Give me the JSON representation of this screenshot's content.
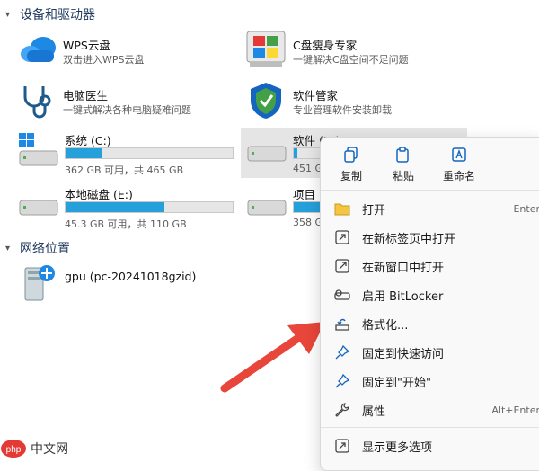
{
  "sections": {
    "devices": "设备和驱动器",
    "network": "网络位置"
  },
  "apps": [
    {
      "name": "WPS云盘",
      "desc": "双击进入WPS云盘",
      "icon": "cloud-icon"
    },
    {
      "name": "C盘瘦身专家",
      "desc": "一键解决C盘空间不足问题",
      "icon": "windows-logo-icon"
    },
    {
      "name": "电脑医生",
      "desc": "一键式解决各种电脑疑难问题",
      "icon": "stethoscope-icon"
    },
    {
      "name": "软件管家",
      "desc": "专业管理软件安装卸载",
      "icon": "shield-icon"
    }
  ],
  "drives": [
    {
      "name": "系统 (C:)",
      "space": "362 GB 可用，共 465 GB",
      "used_fraction": 0.22
    },
    {
      "name": "软件 (D:)",
      "space": "451 G",
      "used_fraction": 0.02
    },
    {
      "name": "本地磁盘 (E:)",
      "space": "45.3 GB 可用，共 110 GB",
      "used_fraction": 0.59
    },
    {
      "name": "项目",
      "space": "358 G",
      "used_fraction": 0.25
    }
  ],
  "network_items": [
    {
      "name": "gpu (pc-20241018gzid)"
    }
  ],
  "context_menu": {
    "quick_actions": [
      "复制",
      "粘贴",
      "重命名"
    ],
    "items": [
      {
        "label": "打开",
        "shortcut": "Enter",
        "icon": "folder-icon"
      },
      {
        "label": "在新标签页中打开",
        "shortcut": "",
        "icon": "new-tab-icon"
      },
      {
        "label": "在新窗口中打开",
        "shortcut": "",
        "icon": "new-window-icon"
      },
      {
        "label": "启用 BitLocker",
        "shortcut": "",
        "icon": "key-icon"
      },
      {
        "label": "格式化...",
        "shortcut": "",
        "icon": "format-icon"
      },
      {
        "label": "固定到快速访问",
        "shortcut": "",
        "icon": "pin-icon"
      },
      {
        "label": "固定到\"开始\"",
        "shortcut": "",
        "icon": "pin-icon"
      },
      {
        "label": "属性",
        "shortcut": "Alt+Enter",
        "icon": "wrench-icon"
      }
    ],
    "more": "显示更多选项"
  },
  "watermark": {
    "text": "中文网",
    "logo": "php"
  },
  "colors": {
    "accent": "#26a0da",
    "arrow": "#e8463a"
  }
}
